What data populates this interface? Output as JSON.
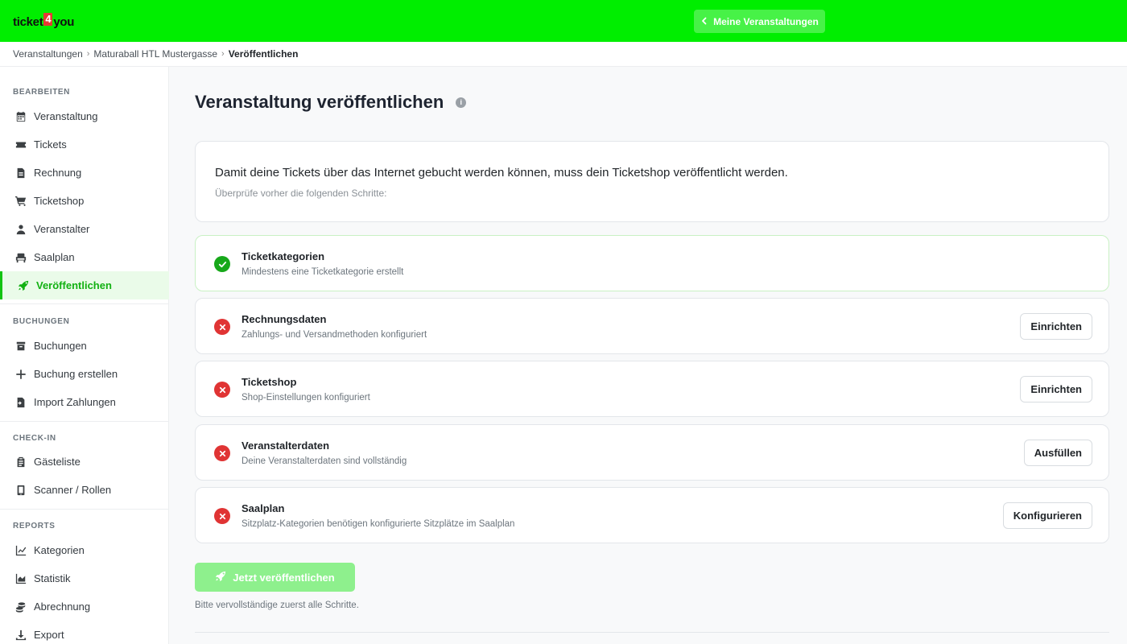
{
  "header": {
    "logo_left": "ticket",
    "logo_four": "4",
    "logo_right": "you",
    "nav_button": "Meine Veranstaltungen",
    "accent_color": "#00ee00"
  },
  "breadcrumb": [
    "Veranstaltungen",
    "Maturaball HTL Mustergasse",
    "Veröffentlichen"
  ],
  "sidebar": {
    "sections": [
      {
        "title": "BEARBEITEN",
        "items": [
          {
            "label": "Veranstaltung",
            "icon": "calendar-icon"
          },
          {
            "label": "Tickets",
            "icon": "ticket-icon"
          },
          {
            "label": "Rechnung",
            "icon": "invoice-icon"
          },
          {
            "label": "Ticketshop",
            "icon": "cart-icon"
          },
          {
            "label": "Veranstalter",
            "icon": "user-icon"
          },
          {
            "label": "Saalplan",
            "icon": "seat-icon"
          },
          {
            "label": "Veröffentlichen",
            "icon": "rocket-icon",
            "active": true
          }
        ]
      },
      {
        "title": "BUCHUNGEN",
        "items": [
          {
            "label": "Buchungen",
            "icon": "box-icon"
          },
          {
            "label": "Buchung erstellen",
            "icon": "plus-icon"
          },
          {
            "label": "Import Zahlungen",
            "icon": "import-icon"
          }
        ]
      },
      {
        "title": "CHECK-IN",
        "items": [
          {
            "label": "Gästeliste",
            "icon": "clipboard-icon"
          },
          {
            "label": "Scanner / Rollen",
            "icon": "phone-icon"
          }
        ]
      },
      {
        "title": "REPORTS",
        "items": [
          {
            "label": "Kategorien",
            "icon": "line-chart-icon"
          },
          {
            "label": "Statistik",
            "icon": "area-chart-icon"
          },
          {
            "label": "Abrechnung",
            "icon": "coins-icon"
          },
          {
            "label": "Export",
            "icon": "download-icon"
          }
        ]
      }
    ]
  },
  "main": {
    "title": "Veranstaltung veröffentlichen",
    "info_glyph": "i",
    "intro_text": "Damit deine Tickets über das Internet gebucht werden können, muss dein Ticketshop veröffentlicht werden.",
    "intro_sub": "Überprüfe vorher die folgenden Schritte:",
    "steps": [
      {
        "title": "Ticketkategorien",
        "desc": "Mindestens eine Ticketkategorie erstellt",
        "status": "done",
        "action": ""
      },
      {
        "title": "Rechnungsdaten",
        "desc": "Zahlungs- und Versandmethoden konfiguriert",
        "status": "missing",
        "action": "Einrichten"
      },
      {
        "title": "Ticketshop",
        "desc": "Shop-Einstellungen konfiguriert",
        "status": "missing",
        "action": "Einrichten"
      },
      {
        "title": "Veranstalterdaten",
        "desc": "Deine Veranstalterdaten sind vollständig",
        "status": "missing",
        "action": "Ausfüllen"
      },
      {
        "title": "Saalplan",
        "desc": "Sitzplatz-Kategorien benötigen konfigurierte Sitzplätze im Saalplan",
        "status": "missing",
        "action": "Konfigurieren"
      }
    ],
    "publish_button": "Jetzt veröffentlichen",
    "hint": "Bitte vervollständige zuerst alle Schritte."
  }
}
